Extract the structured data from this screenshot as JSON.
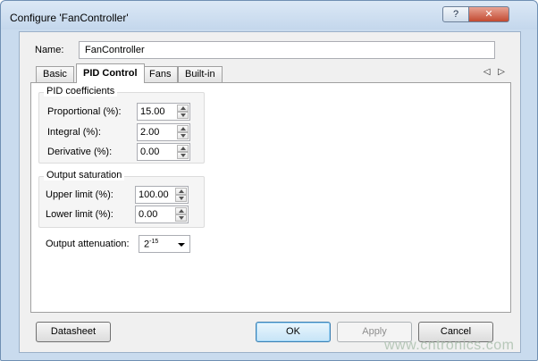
{
  "window": {
    "title": "Configure 'FanController'",
    "help_label": "?",
    "close_label": "✕"
  },
  "name": {
    "label": "Name:",
    "value": "FanController"
  },
  "tabs": [
    {
      "label": "Basic"
    },
    {
      "label": "PID Control"
    },
    {
      "label": "Fans"
    },
    {
      "label": "Built-in"
    }
  ],
  "tab_scroll": "◁ ▷",
  "pid": {
    "group_label": "PID coefficients",
    "proportional": {
      "label": "Proportional (%):",
      "value": "15.00"
    },
    "integral": {
      "label": "Integral (%):",
      "value": "2.00"
    },
    "derivative": {
      "label": "Derivative (%):",
      "value": "0.00"
    }
  },
  "saturation": {
    "group_label": "Output saturation",
    "upper": {
      "label": "Upper limit (%):",
      "value": "100.00"
    },
    "lower": {
      "label": "Lower limit (%):",
      "value": "0.00"
    }
  },
  "attenuation": {
    "label": "Output attenuation:",
    "base": "2",
    "exponent": "-15"
  },
  "buttons": {
    "datasheet": "Datasheet",
    "ok": "OK",
    "apply": "Apply",
    "cancel": "Cancel"
  },
  "watermark": "www.cntronics.com"
}
